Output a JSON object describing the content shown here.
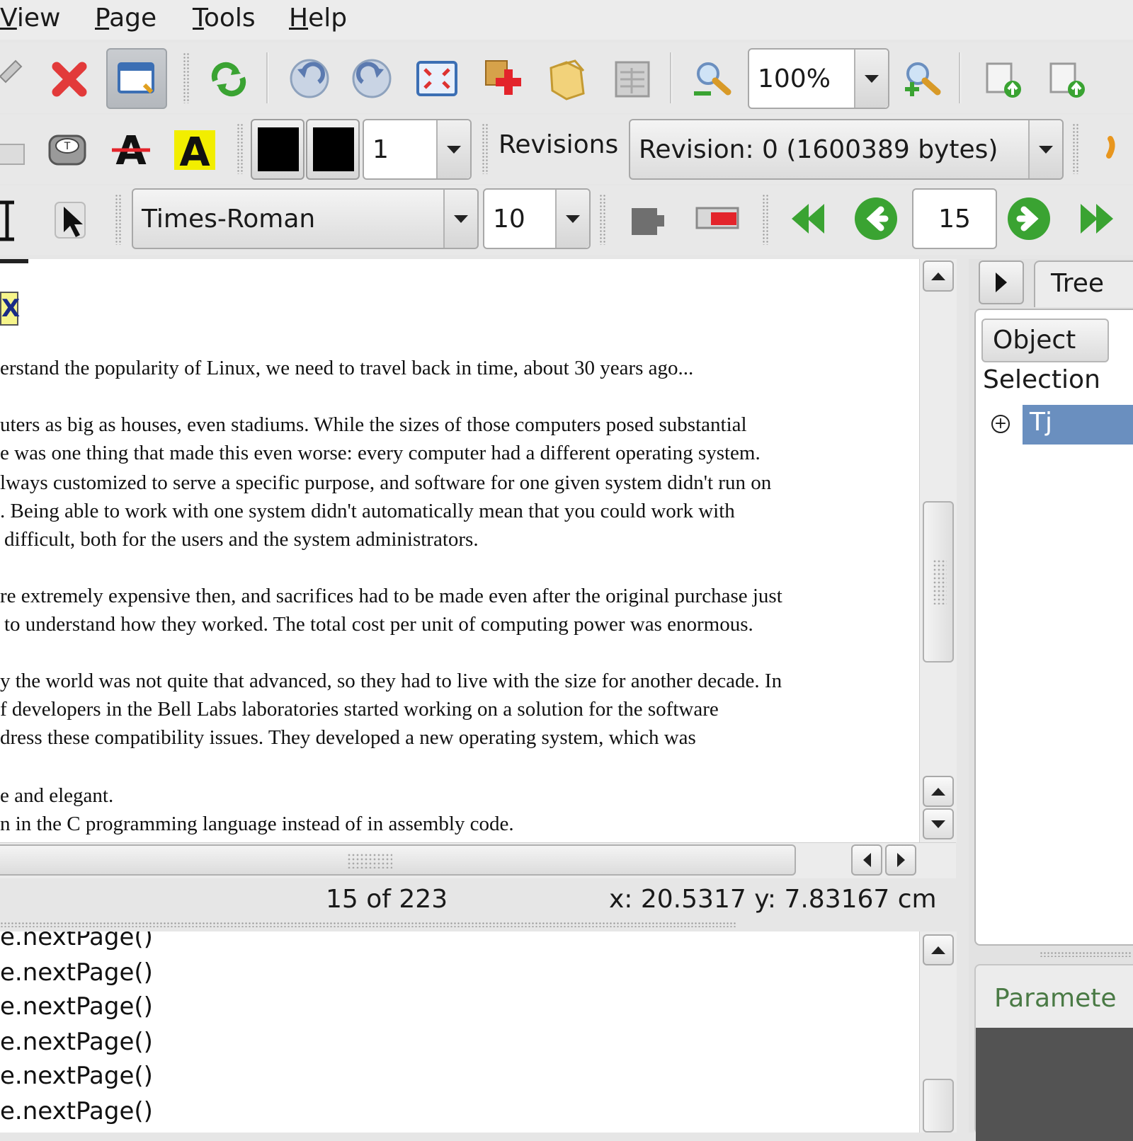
{
  "menu": {
    "items": [
      {
        "label": "View",
        "accel": "V",
        "rest": "iew"
      },
      {
        "label": "Page",
        "accel": "P",
        "rest": "age"
      },
      {
        "label": "Tools",
        "accel": "T",
        "rest": "ools"
      },
      {
        "label": "Help",
        "accel": "H",
        "rest": "elp"
      }
    ]
  },
  "toolbar1": {
    "zoom_value": "100%"
  },
  "toolbar2": {
    "line_width": "1",
    "revisions_label": "Revisions",
    "revision_value": "Revision: 0 (1600389 bytes)"
  },
  "toolbar3": {
    "font_value": "Times-Roman",
    "font_size": "10",
    "page_number": "15"
  },
  "document": {
    "highlight_char": "X",
    "lines": [
      "erstand the popularity of Linux, we need to travel back in time, about 30 years ago...",
      "uters as big as houses, even stadiums. While the sizes of those computers posed substantial",
      "e was one thing that made this even worse: every computer had a different operating system.",
      "lways customized to serve a specific purpose, and software for one given system didn't run on",
      ". Being able to work with one system didn't automatically mean that you could work with",
      "difficult, both for the users and the system administrators.",
      "re extremely expensive then, and sacrifices had to be made even after the original purchase just",
      "to understand how they worked. The total cost per unit of computing power was enormous.",
      "y the world was not quite that advanced, so they had to live with the size for another decade. In",
      "f developers in the Bell Labs laboratories started working on a solution for the software",
      "dress these compatibility issues. They developed a new operating system, which was",
      "e and elegant.",
      "n in the C programming language instead of in assembly code."
    ]
  },
  "status": {
    "page_info": "15 of 223",
    "coords": "x: 20.5317 y: 7.83167 cm"
  },
  "console": {
    "lines": [
      "e.nextPage()",
      "e.nextPage()",
      "e.nextPage()",
      "e.nextPage()",
      "e.nextPage()",
      "e.nextPage()"
    ]
  },
  "right_panel": {
    "tab_label": "Tree",
    "column_header": "Object",
    "selection_label": "Selection",
    "tree_item": "Tj",
    "params_label": "Paramete"
  },
  "colors": {
    "accent_green": "#3aa332",
    "selection_blue": "#6a8fbf",
    "params_text": "#4a7a45"
  }
}
